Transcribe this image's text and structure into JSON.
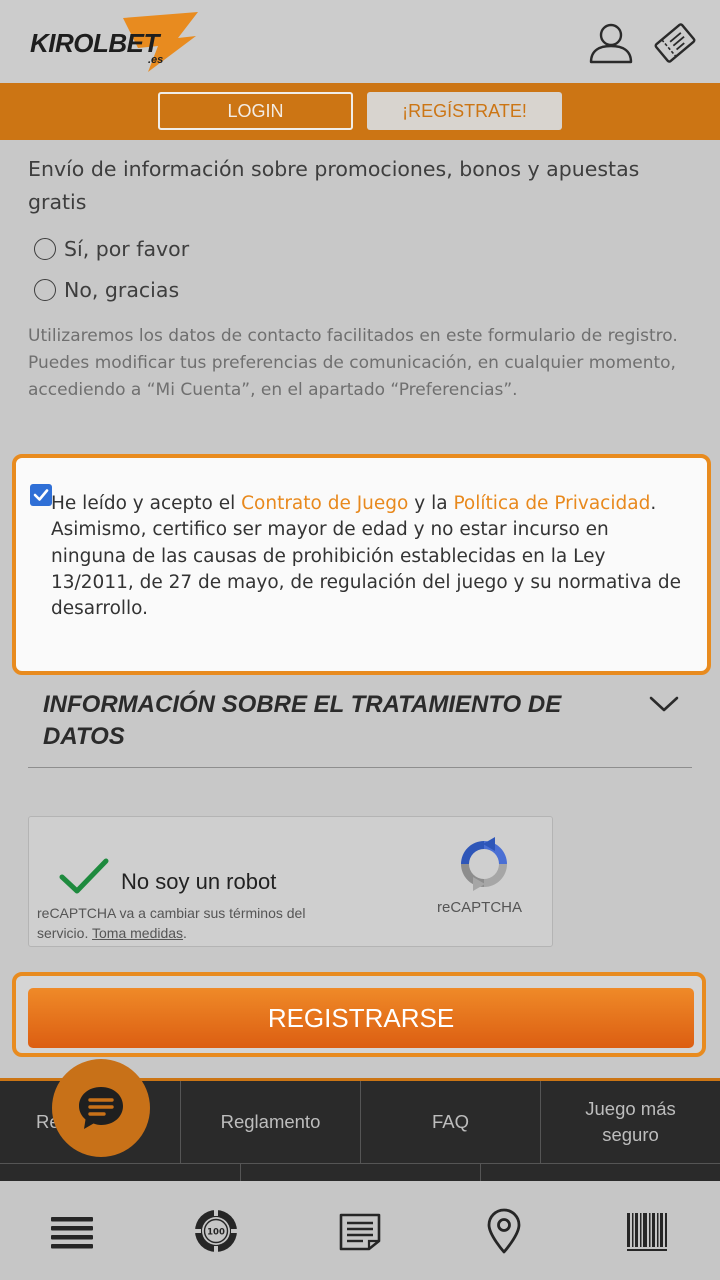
{
  "brand": {
    "name": "KIROLBET",
    "suffix": ".es"
  },
  "auth": {
    "login_label": "LOGIN",
    "register_label": "¡REGÍSTRATE!"
  },
  "promo": {
    "title": "Envío de información sobre promociones, bonos y apuestas gratis",
    "option_yes": "Sí, por favor",
    "option_no": "No, gracias",
    "note": "Utilizaremos los datos de contacto facilitados en este formulario de registro. Puedes modificar tus preferencias de comunicación, en cualquier momento, accediendo a “Mi Cuenta”, en el apartado “Preferencias”."
  },
  "consent": {
    "checked": true,
    "text_1": "He leído y acepto el ",
    "link_contract": "Contrato de Juego",
    "text_2": " y la ",
    "link_privacy": "Política de Privacidad",
    "text_3": ".",
    "text_4": "Asimismo, certifico ser mayor de edad y no estar incurso en ninguna de las causas de prohibición establecidas en la Ley 13/2011, de 27 de mayo, de regulación del juego y su normativa de desarrollo."
  },
  "info_section": {
    "title": "INFORMACIÓN SOBRE EL TRATAMIENTO DE DATOS"
  },
  "recaptcha": {
    "label": "No soy un robot",
    "note_text": "reCAPTCHA va a cambiar sus términos del servicio.",
    "note_link": "Toma medidas",
    "note_end": ".",
    "brand": "reCAPTCHA"
  },
  "submit": {
    "label": "REGISTRARSE"
  },
  "footer": {
    "links": [
      "Responsable",
      "Reglamento",
      "FAQ",
      "Juego más seguro"
    ]
  },
  "colors": {
    "accent": "#cc7514",
    "link": "#e8891d",
    "checkbox": "#2f6fd6"
  },
  "icons": {
    "header": [
      "user-icon",
      "ticket-icon"
    ],
    "nav": [
      "menu-icon",
      "casino-chip-icon",
      "betslip-icon",
      "location-pin-icon",
      "barcode-icon"
    ],
    "chat": "chat-icon"
  }
}
